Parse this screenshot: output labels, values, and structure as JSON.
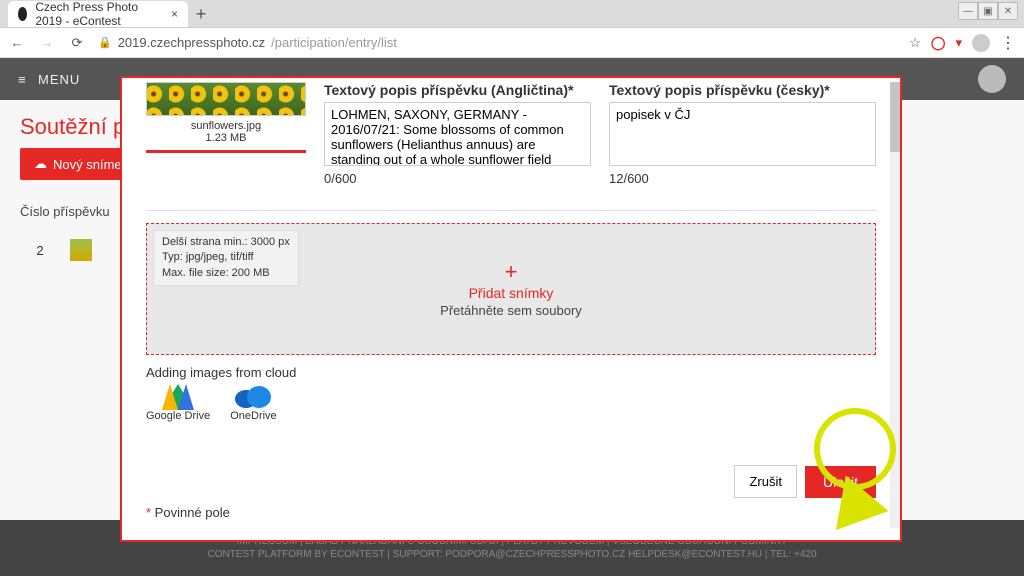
{
  "window": {
    "minimize": "—",
    "maximize": "▣",
    "close": "✕"
  },
  "browser": {
    "tab_title": "Czech Press Photo 2019 - eContest",
    "new_tab": "+",
    "url_host": "2019.czechpressphoto.cz",
    "url_path": "/participation/entry/list"
  },
  "page": {
    "menu_label": "MENU",
    "bg_heading": "Soutěžní příspěvky",
    "bg_new_button": "Nový snímek",
    "bg_col_number": "Číslo příspěvku",
    "bg_row_number": "2"
  },
  "modal": {
    "thumb_filename": "sunflowers.jpg",
    "thumb_size": "1.23 MB",
    "label_desc_en": "Textový popis příspěvku (Angličtina)*",
    "value_desc_en": "LOHMEN, SAXONY, GERMANY - 2016/07/21: Some blossoms of common sunflowers (Helianthus annuus) are standing out of a whole sunflower field",
    "counter_en": "0/600",
    "label_desc_cz": "Textový popis příspěvku (česky)*",
    "value_desc_cz": "popisek v ČJ",
    "counter_cz": "12/600",
    "specs_line1": "Delší strana min.:  3000 px",
    "specs_line2": "Typ:  jpg/jpeg, tif/tiff",
    "specs_line3": "Max. file size:  200 MB",
    "dz_title": "Přidat snímky",
    "dz_sub": "Přetáhněte sem soubory",
    "cloud_label": "Adding images from cloud",
    "cloud_gdrive": "Google Drive",
    "cloud_onedrive": "OneDrive",
    "btn_cancel": "Zrušit",
    "btn_save": "Uložit",
    "required": "Povinné pole"
  },
  "footer": {
    "line1": "IMPRESSUM | ZÁSADY NAKLÁDÁNÍ S OSOBNÍMI ÚDAJI | PLATBY PŘEVODEM | VŠEOBECNÉ OBCHODNÍ PODMÍNKY",
    "line2": "CONTEST PLATFORM BY ECONTEST | SUPPORT: PODPORA@CZECHPRESSPHOTO.CZ  HELPDESK@ECONTEST.HU | TEL: +420"
  }
}
